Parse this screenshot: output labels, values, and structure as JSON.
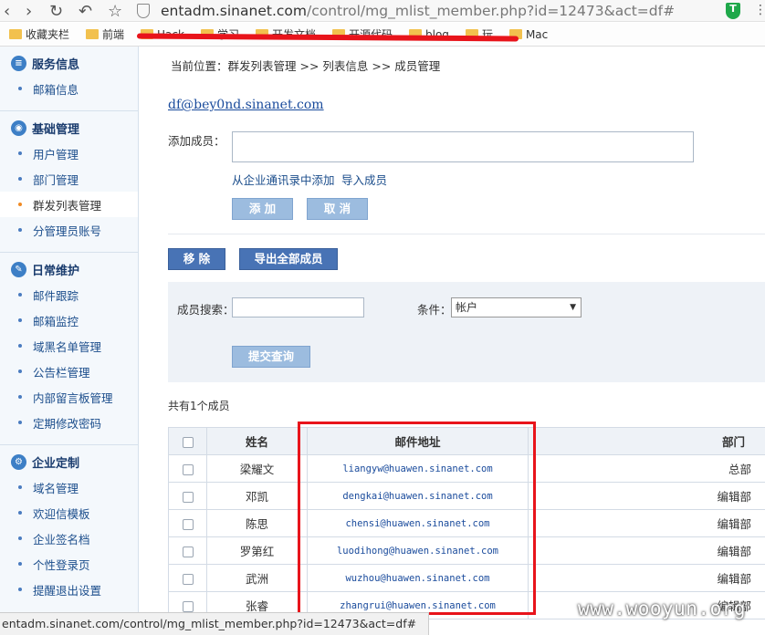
{
  "browser": {
    "url_host": "entadm.sinanet.com",
    "url_path": "/control/mg_mlist_member.php?id=12473&act=df#",
    "bookmarks": [
      "收藏夹栏",
      "前端",
      "Hack",
      "学习",
      "开发文档",
      "开源代码",
      "blog",
      "玩",
      "Mac"
    ],
    "status_url": "entadm.sinanet.com/control/mg_mlist_member.php?id=12473&act=df#"
  },
  "sidebar": {
    "sections": [
      {
        "title": "服务信息",
        "items": [
          "邮箱信息"
        ]
      },
      {
        "title": "基础管理",
        "items": [
          "用户管理",
          "部门管理",
          "群发列表管理",
          "分管理员账号"
        ]
      },
      {
        "title": "日常维护",
        "items": [
          "邮件跟踪",
          "邮箱监控",
          "域黑名单管理",
          "公告栏管理",
          "内部留言板管理",
          "定期修改密码"
        ]
      },
      {
        "title": "企业定制",
        "items": [
          "域名管理",
          "欢迎信模板",
          "企业签名档",
          "个性登录页",
          "提醒退出设置"
        ]
      }
    ]
  },
  "main": {
    "breadcrumb": "当前位置：群发列表管理 >> 列表信息 >> 成员管理",
    "group_email": "df@bey0nd.sinanet.com",
    "add_member_label": "添加成员：",
    "add_from_directory": "从企业通讯录中添加",
    "import_members": "导入成员",
    "add_button": "添 加",
    "cancel_button": "取 消",
    "remove_button": "移 除",
    "export_button": "导出全部成员",
    "search_label": "成员搜索：",
    "condition_label": "条件：",
    "condition_value": "帐户",
    "submit_button": "提交查询",
    "member_count": "共有1个成员"
  },
  "table": {
    "headers": [
      "姓名",
      "邮件地址",
      "部门"
    ],
    "rows": [
      {
        "name": "梁耀文",
        "email": "liangyw@huawen.sinanet.com",
        "dept": "总部"
      },
      {
        "name": "邓凯",
        "email": "dengkai@huawen.sinanet.com",
        "dept": "编辑部"
      },
      {
        "name": "陈思",
        "email": "chensi@huawen.sinanet.com",
        "dept": "编辑部"
      },
      {
        "name": "罗第红",
        "email": "luodihong@huawen.sinanet.com",
        "dept": "编辑部"
      },
      {
        "name": "武洲",
        "email": "wuzhou@huawen.sinanet.com",
        "dept": "编辑部"
      },
      {
        "name": "张睿",
        "email": "zhangrui@huawen.sinanet.com",
        "dept": "编辑部"
      }
    ]
  },
  "watermark": "www.wooyun.org"
}
